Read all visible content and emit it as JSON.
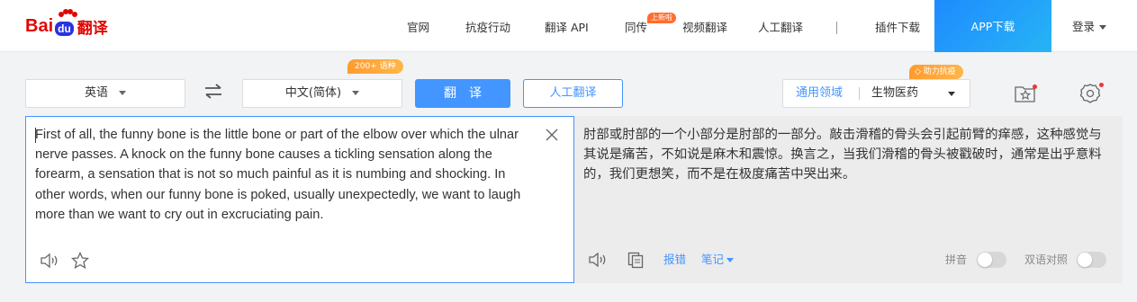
{
  "header": {
    "logo": {
      "bai": "Bai",
      "du": "du",
      "fanyi": "翻译"
    },
    "nav": [
      {
        "label": "官网"
      },
      {
        "label": "抗疫行动"
      },
      {
        "label": "翻译 API"
      },
      {
        "label": "同传",
        "badge": "上新啦"
      },
      {
        "label": "视频翻译"
      },
      {
        "label": "人工翻译"
      },
      {
        "label": "插件下载"
      }
    ],
    "app_download": "APP下载",
    "login": "登录"
  },
  "toolbar": {
    "source_lang": "英语",
    "target_lang": "中文(简体)",
    "lang_badge": "200+ 语种",
    "translate_button": "翻译",
    "human_button": "人工翻译",
    "domain_badge": "助力抗疫",
    "domain_label": "通用领域",
    "domain_value": "生物医药"
  },
  "input": {
    "text": "First of all, the funny bone is the little bone or part of the elbow over which the ulnar nerve passes. A knock on the funny bone causes a tickling sensation along the forearm, a sensation that is not so much painful as it is numbing and shocking. In other words, when our funny bone is poked, usually unexpectedly, we want to laugh more than we want to cry out in excruciating pain."
  },
  "output": {
    "text": "肘部或肘部的一个小部分是肘部的一部分。敲击滑稽的骨头会引起前臂的痒感，这种感觉与其说是痛苦，不如说是麻木和震惊。换言之，当我们滑稽的骨头被戳破时，通常是出乎意料的，我们更想笑，而不是在极度痛苦中哭出来。",
    "report_link": "报错",
    "notes_link": "笔记",
    "pinyin_label": "拼音",
    "bilingual_label": "双语对照"
  },
  "colors": {
    "accent": "#4395ff",
    "brand_red": "#e10601",
    "brand_blue": "#2932e1",
    "badge_orange": "#ff9b2f"
  }
}
